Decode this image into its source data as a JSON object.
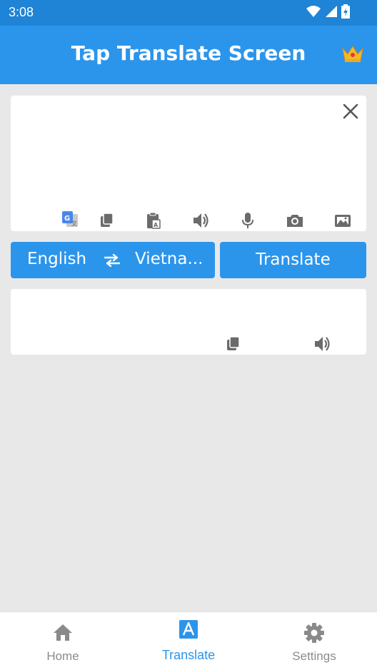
{
  "status_bar": {
    "time": "3:08"
  },
  "app_bar": {
    "title": "Tap Translate Screen"
  },
  "language": {
    "source": "English",
    "target": "Vietna..."
  },
  "translate_button": "Translate",
  "input": {
    "text": ""
  },
  "output": {
    "text": ""
  },
  "nav": [
    {
      "label": "Home",
      "icon": "home-icon",
      "active": false
    },
    {
      "label": "Translate",
      "icon": "translate-icon",
      "active": true
    },
    {
      "label": "Settings",
      "icon": "gear-icon",
      "active": false
    }
  ],
  "colors": {
    "primary": "#2b95ec",
    "status_bar": "#1f84d6",
    "background": "#e9e8e9",
    "icon_gray": "#6b6b6b"
  }
}
